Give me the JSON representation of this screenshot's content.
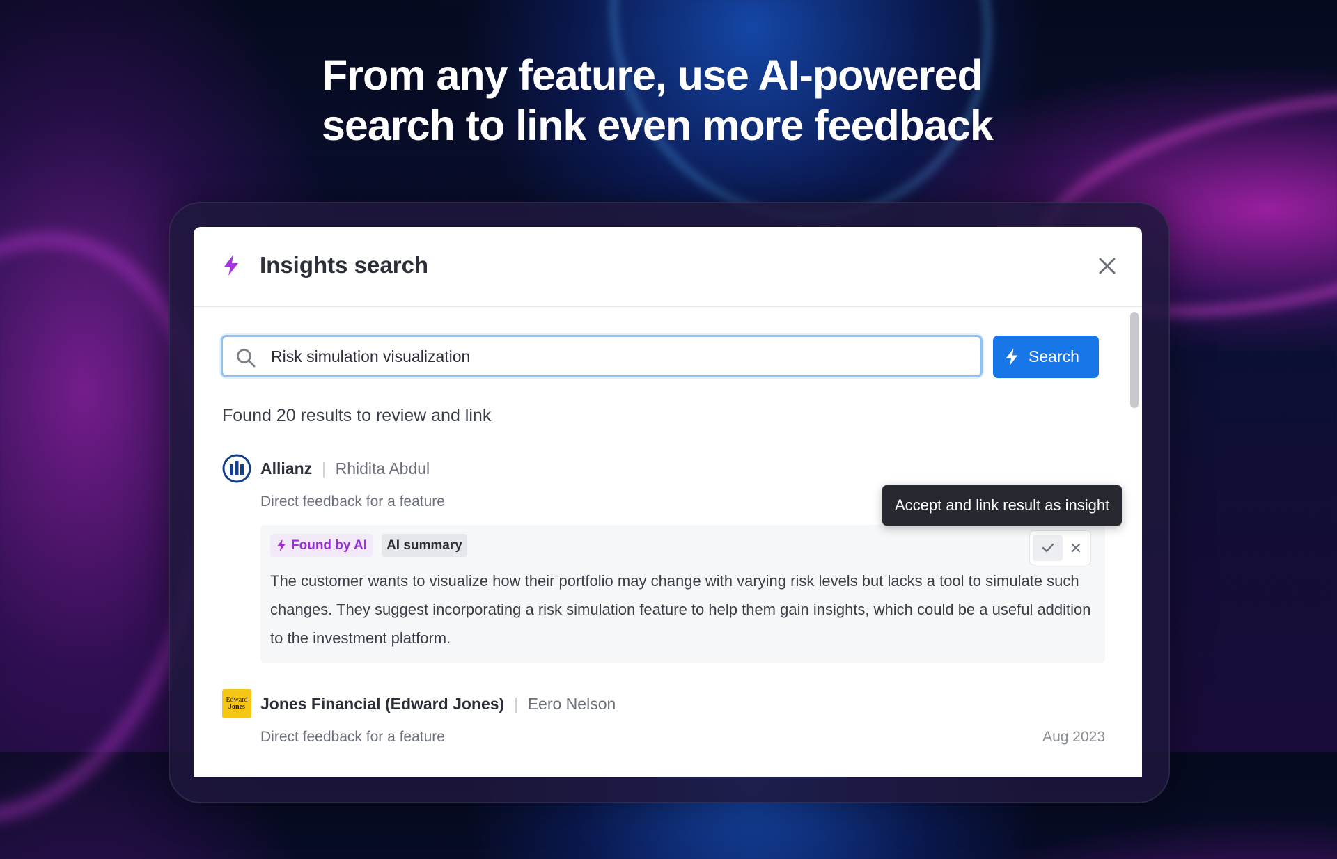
{
  "headline": {
    "line1": "From any feature, use AI-powered",
    "line2": "search to link even more feedback"
  },
  "modal": {
    "title": "Insights search",
    "title_icon": "bolt-icon",
    "close_icon": "close-icon"
  },
  "search": {
    "value": "Risk simulation visualization",
    "button_label": "Search",
    "icon": "search-icon"
  },
  "results_count_text": "Found 20 results to review and link",
  "results": [
    {
      "company": "Allianz",
      "person": "Rhidita Abdul",
      "subtitle": "Direct feedback for a feature",
      "badge_ai": "Found by AI",
      "badge_summary": "AI summary",
      "summary": "The customer wants to visualize how their portfolio may change with varying risk levels but lacks a tool to simulate such changes. They suggest incorporating a risk simulation feature to help them gain insights, which could be a useful addition to the investment platform."
    },
    {
      "company": "Jones Financial (Edward Jones)",
      "person": "Eero Nelson",
      "subtitle": "Direct feedback for a feature",
      "date": "Aug 2023",
      "logo_text_line1": "Edward",
      "logo_text_line2": "Jones"
    }
  ],
  "tooltip": "Accept and link result as insight",
  "colors": {
    "accent_blue": "#1777e8",
    "ai_purple": "#9a2fd6",
    "tooltip_bg": "#262a30"
  }
}
